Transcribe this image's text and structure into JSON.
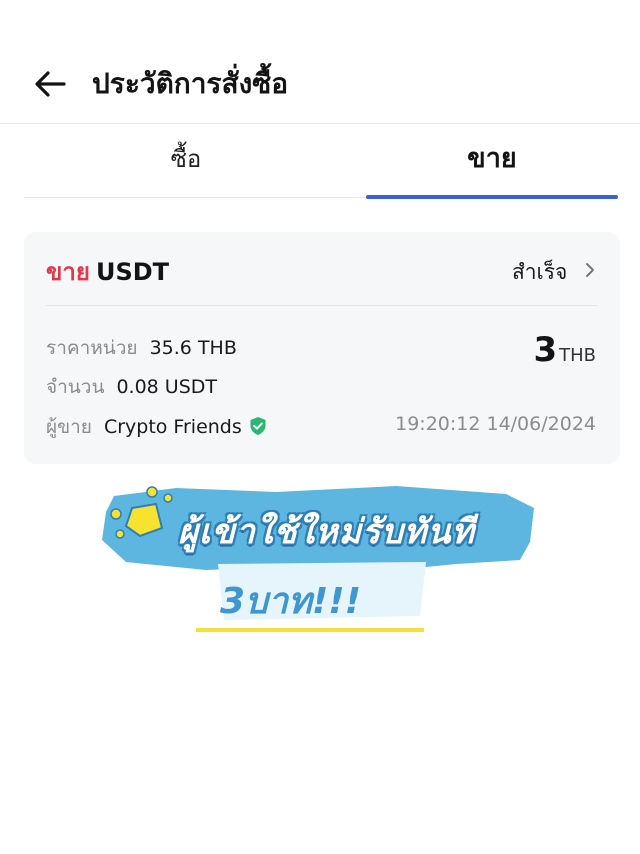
{
  "header": {
    "title": "ประวัติการสั่งซื้อ",
    "back_icon": "arrow-left-icon"
  },
  "tabs": [
    {
      "label": "ซื้อ",
      "active": false
    },
    {
      "label": "ขาย",
      "active": true
    }
  ],
  "colors": {
    "accent": "#3b5fd6",
    "sell": "#e0394a",
    "verified": "#2ab673",
    "promo_blue": "#5db6df",
    "promo_yellow": "#f2e23c"
  },
  "order": {
    "side": "ขาย",
    "coin": "USDT",
    "status": "สำเร็จ",
    "unit_price_label": "ราคาหน่วย",
    "unit_price_value": "35.6 THB",
    "quantity_label": "จำนวน",
    "quantity_value": "0.08 USDT",
    "seller_label": "ผู้ขาย",
    "seller_name": "Crypto Friends",
    "total_amount": "3",
    "total_currency": "THB",
    "datetime": "19:20:12 14/06/2024"
  },
  "promo": {
    "line1": "ผู้เข้าใช้ใหม่รับทันที",
    "line2": "3บาท!!!"
  }
}
